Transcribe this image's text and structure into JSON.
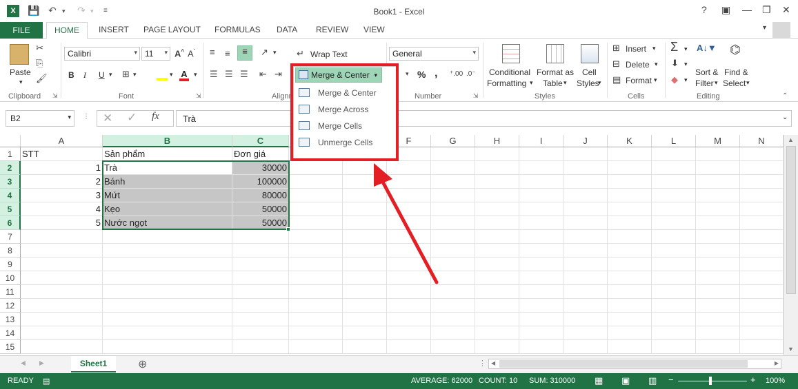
{
  "window": {
    "title": "Book1 - Excel",
    "help": "?",
    "min": "—",
    "restore": "❐",
    "close": "✕"
  },
  "tabs": {
    "file": "FILE",
    "home": "HOME",
    "insert": "INSERT",
    "page_layout": "PAGE LAYOUT",
    "formulas": "FORMULAS",
    "data": "DATA",
    "review": "REVIEW",
    "view": "VIEW"
  },
  "ribbon": {
    "clipboard": {
      "label": "Clipboard",
      "paste": "Paste"
    },
    "font": {
      "label": "Font",
      "name": "Calibri",
      "size": "11",
      "bold": "B",
      "italic": "I",
      "underline": "U"
    },
    "alignment": {
      "label": "Alignm",
      "wrap_text": "Wrap Text"
    },
    "number": {
      "label": "Number",
      "format": "General",
      "percent": "%",
      "comma": ","
    },
    "styles": {
      "label": "Styles",
      "conditional": "Conditional",
      "formatting": "Formatting",
      "format_as": "Format as",
      "table": "Table",
      "cell": "Cell",
      "cell_styles": "Styles"
    },
    "cells": {
      "label": "Cells",
      "insert": "Insert",
      "delete": "Delete",
      "format": "Format"
    },
    "editing": {
      "label": "Editing",
      "sort": "Sort &",
      "filter": "Filter",
      "find": "Find &",
      "select": "Select"
    }
  },
  "merge_menu": {
    "button": "Merge & Center",
    "items": [
      "Merge & Center",
      "Merge Across",
      "Merge Cells",
      "Unmerge Cells"
    ]
  },
  "formula_bar": {
    "name_box": "B2",
    "fx": "fx",
    "value": "Trà"
  },
  "columns": [
    "A",
    "B",
    "C",
    "D",
    "E",
    "F",
    "G",
    "H",
    "I",
    "J",
    "K",
    "L",
    "M",
    "N"
  ],
  "rows": [
    "1",
    "2",
    "3",
    "4",
    "5",
    "6",
    "7",
    "8",
    "9",
    "10",
    "11",
    "12",
    "13",
    "14",
    "15"
  ],
  "cells": {
    "header": [
      "STT",
      "Sản phẩm",
      "Đơn giá"
    ],
    "data": [
      [
        "1",
        "Trà",
        "30000"
      ],
      [
        "2",
        "Bánh",
        "100000"
      ],
      [
        "3",
        "Mứt",
        "80000"
      ],
      [
        "4",
        "Kẹo",
        "50000"
      ],
      [
        "5",
        "Nước ngọt",
        "50000"
      ]
    ]
  },
  "sheet": {
    "tab": "Sheet1",
    "add": "⊕"
  },
  "status": {
    "ready": "READY",
    "average": "AVERAGE: 62000",
    "count": "COUNT: 10",
    "sum": "SUM: 310000",
    "zoom": "100%"
  },
  "colors": {
    "accent": "#217346",
    "highlight_box": "#e31e24",
    "selection": "#c6c6c6"
  }
}
